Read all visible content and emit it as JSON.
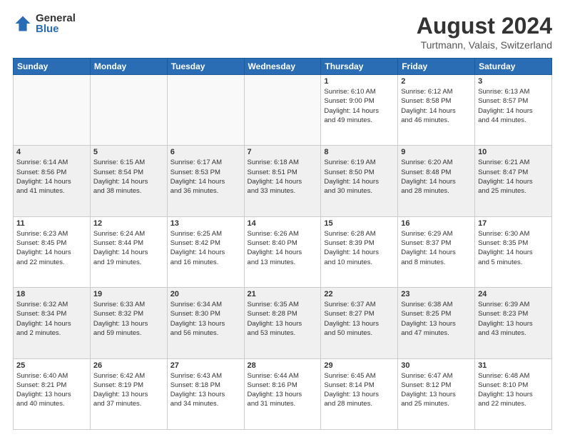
{
  "logo": {
    "general": "General",
    "blue": "Blue"
  },
  "title": "August 2024",
  "location": "Turtmann, Valais, Switzerland",
  "days_of_week": [
    "Sunday",
    "Monday",
    "Tuesday",
    "Wednesday",
    "Thursday",
    "Friday",
    "Saturday"
  ],
  "weeks": [
    [
      {
        "day": "",
        "info": ""
      },
      {
        "day": "",
        "info": ""
      },
      {
        "day": "",
        "info": ""
      },
      {
        "day": "",
        "info": ""
      },
      {
        "day": "1",
        "info": "Sunrise: 6:10 AM\nSunset: 9:00 PM\nDaylight: 14 hours\nand 49 minutes."
      },
      {
        "day": "2",
        "info": "Sunrise: 6:12 AM\nSunset: 8:58 PM\nDaylight: 14 hours\nand 46 minutes."
      },
      {
        "day": "3",
        "info": "Sunrise: 6:13 AM\nSunset: 8:57 PM\nDaylight: 14 hours\nand 44 minutes."
      }
    ],
    [
      {
        "day": "4",
        "info": "Sunrise: 6:14 AM\nSunset: 8:56 PM\nDaylight: 14 hours\nand 41 minutes."
      },
      {
        "day": "5",
        "info": "Sunrise: 6:15 AM\nSunset: 8:54 PM\nDaylight: 14 hours\nand 38 minutes."
      },
      {
        "day": "6",
        "info": "Sunrise: 6:17 AM\nSunset: 8:53 PM\nDaylight: 14 hours\nand 36 minutes."
      },
      {
        "day": "7",
        "info": "Sunrise: 6:18 AM\nSunset: 8:51 PM\nDaylight: 14 hours\nand 33 minutes."
      },
      {
        "day": "8",
        "info": "Sunrise: 6:19 AM\nSunset: 8:50 PM\nDaylight: 14 hours\nand 30 minutes."
      },
      {
        "day": "9",
        "info": "Sunrise: 6:20 AM\nSunset: 8:48 PM\nDaylight: 14 hours\nand 28 minutes."
      },
      {
        "day": "10",
        "info": "Sunrise: 6:21 AM\nSunset: 8:47 PM\nDaylight: 14 hours\nand 25 minutes."
      }
    ],
    [
      {
        "day": "11",
        "info": "Sunrise: 6:23 AM\nSunset: 8:45 PM\nDaylight: 14 hours\nand 22 minutes."
      },
      {
        "day": "12",
        "info": "Sunrise: 6:24 AM\nSunset: 8:44 PM\nDaylight: 14 hours\nand 19 minutes."
      },
      {
        "day": "13",
        "info": "Sunrise: 6:25 AM\nSunset: 8:42 PM\nDaylight: 14 hours\nand 16 minutes."
      },
      {
        "day": "14",
        "info": "Sunrise: 6:26 AM\nSunset: 8:40 PM\nDaylight: 14 hours\nand 13 minutes."
      },
      {
        "day": "15",
        "info": "Sunrise: 6:28 AM\nSunset: 8:39 PM\nDaylight: 14 hours\nand 10 minutes."
      },
      {
        "day": "16",
        "info": "Sunrise: 6:29 AM\nSunset: 8:37 PM\nDaylight: 14 hours\nand 8 minutes."
      },
      {
        "day": "17",
        "info": "Sunrise: 6:30 AM\nSunset: 8:35 PM\nDaylight: 14 hours\nand 5 minutes."
      }
    ],
    [
      {
        "day": "18",
        "info": "Sunrise: 6:32 AM\nSunset: 8:34 PM\nDaylight: 14 hours\nand 2 minutes."
      },
      {
        "day": "19",
        "info": "Sunrise: 6:33 AM\nSunset: 8:32 PM\nDaylight: 13 hours\nand 59 minutes."
      },
      {
        "day": "20",
        "info": "Sunrise: 6:34 AM\nSunset: 8:30 PM\nDaylight: 13 hours\nand 56 minutes."
      },
      {
        "day": "21",
        "info": "Sunrise: 6:35 AM\nSunset: 8:28 PM\nDaylight: 13 hours\nand 53 minutes."
      },
      {
        "day": "22",
        "info": "Sunrise: 6:37 AM\nSunset: 8:27 PM\nDaylight: 13 hours\nand 50 minutes."
      },
      {
        "day": "23",
        "info": "Sunrise: 6:38 AM\nSunset: 8:25 PM\nDaylight: 13 hours\nand 47 minutes."
      },
      {
        "day": "24",
        "info": "Sunrise: 6:39 AM\nSunset: 8:23 PM\nDaylight: 13 hours\nand 43 minutes."
      }
    ],
    [
      {
        "day": "25",
        "info": "Sunrise: 6:40 AM\nSunset: 8:21 PM\nDaylight: 13 hours\nand 40 minutes."
      },
      {
        "day": "26",
        "info": "Sunrise: 6:42 AM\nSunset: 8:19 PM\nDaylight: 13 hours\nand 37 minutes."
      },
      {
        "day": "27",
        "info": "Sunrise: 6:43 AM\nSunset: 8:18 PM\nDaylight: 13 hours\nand 34 minutes."
      },
      {
        "day": "28",
        "info": "Sunrise: 6:44 AM\nSunset: 8:16 PM\nDaylight: 13 hours\nand 31 minutes."
      },
      {
        "day": "29",
        "info": "Sunrise: 6:45 AM\nSunset: 8:14 PM\nDaylight: 13 hours\nand 28 minutes."
      },
      {
        "day": "30",
        "info": "Sunrise: 6:47 AM\nSunset: 8:12 PM\nDaylight: 13 hours\nand 25 minutes."
      },
      {
        "day": "31",
        "info": "Sunrise: 6:48 AM\nSunset: 8:10 PM\nDaylight: 13 hours\nand 22 minutes."
      }
    ]
  ]
}
